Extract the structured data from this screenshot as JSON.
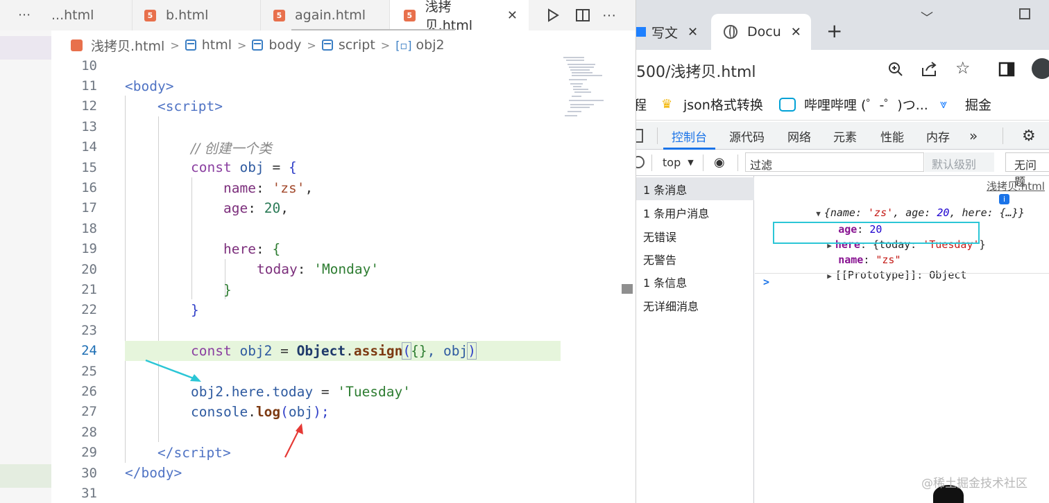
{
  "editor": {
    "tabs": [
      {
        "label": "...html"
      },
      {
        "label": "b.html"
      },
      {
        "label": "again.html"
      },
      {
        "label": "浅拷贝.html",
        "close": "✕"
      }
    ],
    "overflow_label": "···",
    "breadcrumb": [
      "浅拷贝.html",
      "html",
      "body",
      "script",
      "obj2"
    ],
    "lines": [
      {
        "n": "10"
      },
      {
        "n": "11"
      },
      {
        "n": "12"
      },
      {
        "n": "13"
      },
      {
        "n": "14"
      },
      {
        "n": "15"
      },
      {
        "n": "16"
      },
      {
        "n": "17"
      },
      {
        "n": "18"
      },
      {
        "n": "19"
      },
      {
        "n": "20"
      },
      {
        "n": "21"
      },
      {
        "n": "22"
      },
      {
        "n": "23"
      },
      {
        "n": "24"
      },
      {
        "n": "25"
      },
      {
        "n": "26"
      },
      {
        "n": "27"
      },
      {
        "n": "28"
      },
      {
        "n": "29"
      },
      {
        "n": "30"
      },
      {
        "n": "31"
      }
    ],
    "code": {
      "l11": [
        "<",
        "body",
        ">"
      ],
      "l12": [
        "<",
        "script",
        ">"
      ],
      "l14": "// 创建一个类",
      "l15": [
        "const",
        "obj",
        "=",
        "{"
      ],
      "l16": [
        "name",
        ":",
        "'zs'",
        ","
      ],
      "l17": [
        "age",
        ":",
        "20",
        ","
      ],
      "l19": [
        "here",
        ":",
        "{"
      ],
      "l20": [
        "today",
        ":",
        "'Monday'"
      ],
      "l21": "}",
      "l22": "}",
      "l24": [
        "const",
        "obj2",
        "=",
        "Object",
        ".",
        "assign",
        "(",
        "{}",
        ", obj",
        ")"
      ],
      "l26": [
        "obj2.here.today",
        " = ",
        "'Tuesday'"
      ],
      "l27": [
        "console",
        ".",
        "log",
        "(",
        "obj",
        ");"
      ],
      "l29": [
        "</",
        "script",
        ">"
      ],
      "l30": [
        "</",
        "body",
        ">"
      ]
    }
  },
  "browser": {
    "tabs": [
      {
        "label": "写文",
        "close": "✕"
      },
      {
        "label": "Docu",
        "close": "✕"
      }
    ],
    "new_tab": "+",
    "address": "500/浅拷贝.html",
    "bookmarks": [
      "程",
      "json格式转换",
      "哔哩哔哩 (゜-゜)つ...",
      "掘金"
    ],
    "devtools_tabs": [
      "控制台",
      "源代码",
      "网络",
      "元素",
      "性能",
      "内存"
    ],
    "context": "top",
    "filter_placeholder": "过滤",
    "level": "默认级别",
    "issues": "无问题",
    "sidebar": [
      "1 条消息",
      "1 条用户消息",
      "无错误",
      "无警告",
      "1 条信息",
      "无详细消息"
    ],
    "console": {
      "source": "浅拷贝.html",
      "summary_open": "{name: ",
      "summary_name": "'zs'",
      "summary_mid": ", age: ",
      "summary_age": "20",
      "summary_end": ", here: {…}}",
      "age_key": "age",
      "age_val": "20",
      "here_key": "here",
      "here_open": "{today: ",
      "here_val": "'Tuesday'",
      "here_close": "}",
      "name_key": "name",
      "name_val": "\"zs\"",
      "proto": "[[Prototype]]: Object",
      "prompt": ">"
    }
  },
  "watermark": "@稀土掘金技术社区"
}
